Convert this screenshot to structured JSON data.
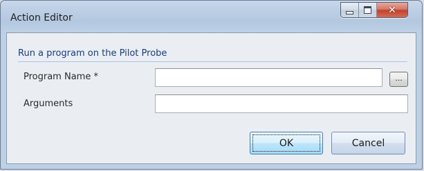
{
  "window": {
    "title": "Action Editor",
    "controls": {
      "minimize_icon": "minimize-icon",
      "maximize_icon": "maximize-icon",
      "close_glyph": "✕"
    }
  },
  "form": {
    "section_header": "Run a program on the Pilot Probe",
    "program_name": {
      "label": "Program Name *",
      "value": "",
      "browse_label": "..."
    },
    "arguments": {
      "label": "Arguments",
      "value": ""
    }
  },
  "buttons": {
    "ok_label": "OK",
    "cancel_label": "Cancel"
  },
  "colors": {
    "section_header": "#1a3c7a",
    "close_button": "#c2412f",
    "default_button_border": "#3c7fb1"
  }
}
